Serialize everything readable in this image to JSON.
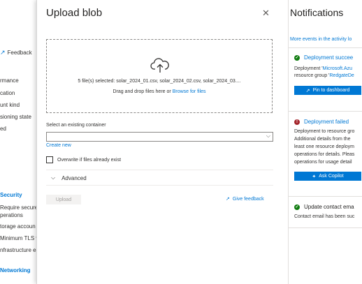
{
  "background": {
    "feedback_label": "Feedback",
    "items": [
      "rmance",
      "cation",
      "unt kind",
      "sioning state",
      "ed"
    ],
    "security_label": "Security",
    "security_items": [
      "Require secure t",
      "perations",
      "torage accoun",
      "Minimum TLS v",
      "nfrastructure e"
    ],
    "networking_label": "Networking"
  },
  "upload": {
    "title": "Upload blob",
    "close_icon": "close-icon",
    "files_selected": "5 file(s) selected: solar_2024_01.csv, solar_2024_02.csv, solar_2024_03....",
    "drag_text": "Drag and drop files here",
    "or_text": "or",
    "browse_label": "Browse for files",
    "container_label": "Select an existing container",
    "container_value": "",
    "create_new_label": "Create new",
    "overwrite_label": "Overwrite if files already exist",
    "advanced_label": "Advanced",
    "upload_button": "Upload",
    "give_feedback_label": "Give feedback"
  },
  "notifications": {
    "title": "Notifications",
    "more_events": "More events in the activity lo",
    "cards": [
      {
        "status": "success",
        "title": "Deployment succee",
        "line1_prefix": "Deployment '",
        "line1_link": "Microsoft.Azu",
        "line2_prefix": "resource group '",
        "line2_link": "RedgateDe",
        "button": "Pin to dashboard"
      },
      {
        "status": "error",
        "title": "Deployment failed",
        "lines": [
          "Deployment to resource gro",
          "Additional details from the",
          "least one resource deploym",
          "operations for details. Pleas",
          "operations for usage detail"
        ],
        "button": "Ask Copilot"
      },
      {
        "status": "success",
        "title": "Update contact ema",
        "lines": [
          "Contact email has been suc"
        ]
      }
    ]
  },
  "colors": {
    "accent": "#0078d4",
    "success": "#107c10",
    "error": "#a4262c"
  }
}
